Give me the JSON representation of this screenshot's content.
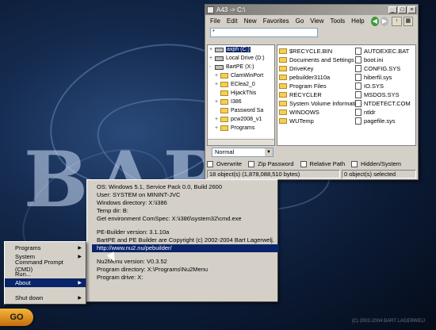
{
  "explorer": {
    "title": "A43 -> C:\\",
    "menu": [
      "File",
      "Edit",
      "New",
      "Favorites",
      "Go",
      "View",
      "Tools",
      "Help"
    ],
    "address": "*",
    "tree": [
      {
        "label": "axph (C:)",
        "icon": "drive-icon",
        "expand": "+",
        "level": 0,
        "selected": true
      },
      {
        "label": "Local Drive (D:)",
        "icon": "drive-icon",
        "expand": "+",
        "level": 0
      },
      {
        "label": "BartPE (X:)",
        "icon": "drive-icon",
        "expand": "-",
        "level": 0
      },
      {
        "label": "ClamWinPort",
        "icon": "folder-icon",
        "expand": "+",
        "level": 1
      },
      {
        "label": "EClea2_0",
        "icon": "folder-icon",
        "expand": "+",
        "level": 1
      },
      {
        "label": "HijackThis",
        "icon": "folder-icon",
        "expand": "",
        "level": 1
      },
      {
        "label": "I386",
        "icon": "folder-icon",
        "expand": "+",
        "level": 1
      },
      {
        "label": "Password Sa",
        "icon": "folder-icon",
        "expand": "",
        "level": 1
      },
      {
        "label": "pcw2008_v1",
        "icon": "folder-icon",
        "expand": "+",
        "level": 1
      },
      {
        "label": "Programs",
        "icon": "folder-icon",
        "expand": "+",
        "level": 1
      }
    ],
    "files_col1": [
      {
        "label": "$RECYCLE.BIN",
        "icon": "folder-icon"
      },
      {
        "label": "Documents and Settings",
        "icon": "folder-icon"
      },
      {
        "label": "DriveKey",
        "icon": "folder-icon"
      },
      {
        "label": "pebuilder3110a",
        "icon": "folder-icon"
      },
      {
        "label": "Program Files",
        "icon": "folder-icon"
      },
      {
        "label": "RECYCLER",
        "icon": "folder-icon"
      },
      {
        "label": "System Volume Information",
        "icon": "folder-icon"
      },
      {
        "label": "WINDOWS",
        "icon": "folder-icon"
      },
      {
        "label": "WUTemp",
        "icon": "folder-icon"
      }
    ],
    "files_col2": [
      {
        "label": "AUTOEXEC.BAT",
        "icon": "file-icon"
      },
      {
        "label": "boot.ini",
        "icon": "file-icon"
      },
      {
        "label": "CONFIG.SYS",
        "icon": "file-icon"
      },
      {
        "label": "hiberfil.sys",
        "icon": "file-icon"
      },
      {
        "label": "IO.SYS",
        "icon": "file-icon"
      },
      {
        "label": "MSDOS.SYS",
        "icon": "file-icon"
      },
      {
        "label": "NTDETECT.COM",
        "icon": "file-icon"
      },
      {
        "label": "ntldr",
        "icon": "file-icon"
      },
      {
        "label": "pagefile.sys",
        "icon": "file-icon"
      }
    ],
    "view_mode": "Normal",
    "checkboxes": [
      "Overwrite",
      "Zip Password",
      "Relative Path",
      "Hidden/System"
    ],
    "status_left": "18 object(s) (1,878,088,510 bytes)",
    "status_right": "0 object(s) selected"
  },
  "info_popup": {
    "os": "OS: Windows 5.1, Service Pack 0.0, Build 2600",
    "user": "User: SYSTEM on MININT-JVC",
    "windir": "Windows directory: X:\\i386",
    "tempdir": "Temp dir: B:",
    "comspec": "Get environment ComSpec: X:\\i386\\system32\\cmd.exe",
    "pebuilder_version": "PE-Builder version: 3.1.10a",
    "copyright": "BartPE and PE Builder are Copyright (c) 2002-2004 Bart Lagerwelj.",
    "url": "http://www.nu2.nu/pebuilder/",
    "nu2menu_version": "Nu2Menu version: V0.3.52",
    "program_dir": "Program directory: X:\\Programs\\Nu2Menu",
    "program_drive": "Program drive: X:"
  },
  "start_menu": {
    "items": [
      {
        "label": "Programs",
        "submenu": true
      },
      {
        "label": "System",
        "submenu": true
      },
      {
        "label": "Command Prompt (CMD)",
        "submenu": false
      },
      {
        "label": "Run...",
        "submenu": false
      },
      {
        "label": "About",
        "submenu": true,
        "active": true
      }
    ],
    "shutdown": "Shut down",
    "go_label": "GO"
  },
  "desktop": {
    "wallpaper_text": "BART",
    "watermark": "(C) 2002-2004 BART LAGERWEIJ"
  }
}
